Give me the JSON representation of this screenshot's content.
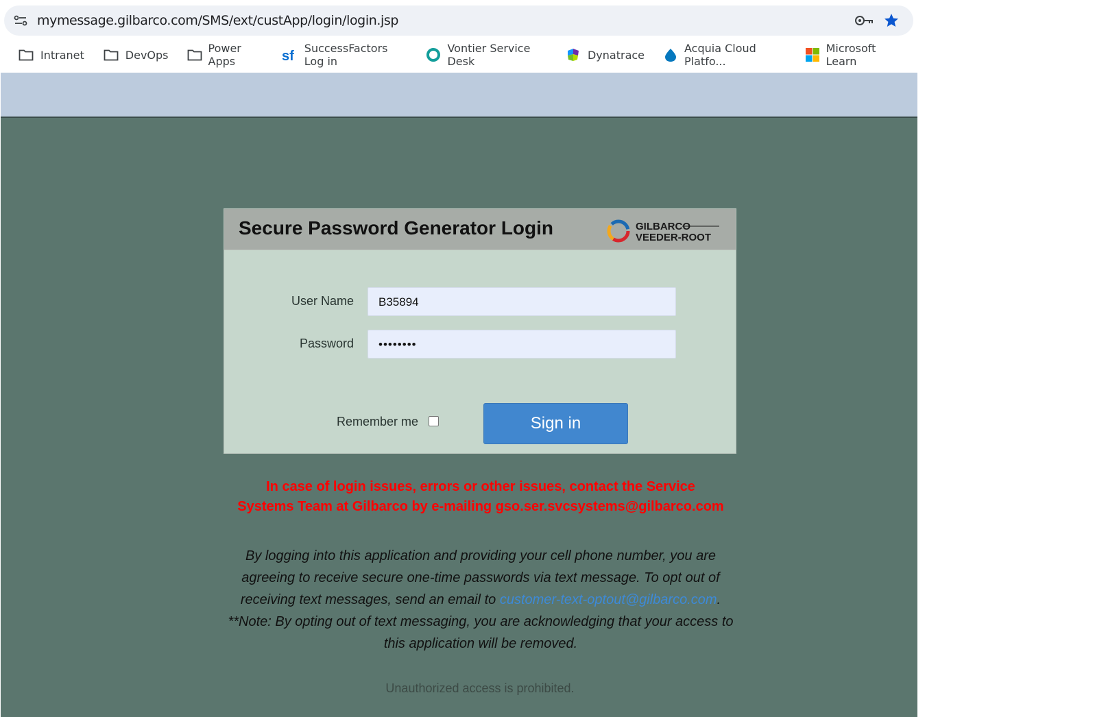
{
  "browser": {
    "url": "mymessage.gilbarco.com/SMS/ext/custApp/login/login.jsp",
    "bookmarks": [
      {
        "label": "Intranet",
        "icon": "folder-icon"
      },
      {
        "label": "DevOps",
        "icon": "folder-icon"
      },
      {
        "label": "Power Apps",
        "icon": "folder-icon"
      },
      {
        "label": "SuccessFactors Log in",
        "icon": "successfactors-icon"
      },
      {
        "label": "Vontier Service Desk",
        "icon": "vontier-icon"
      },
      {
        "label": "Dynatrace",
        "icon": "dynatrace-icon"
      },
      {
        "label": "Acquia Cloud Platfo...",
        "icon": "acquia-icon"
      },
      {
        "label": "Microsoft Learn",
        "icon": "microsoft-icon"
      }
    ]
  },
  "login": {
    "title": "Secure Password Generator Login",
    "logo_text_line1": "GILBARCO",
    "logo_text_line2": "VEEDER-ROOT",
    "username_label": "User Name",
    "username_value": "B35894",
    "password_label": "Password",
    "password_value": "••••••••",
    "remember_label": "Remember me",
    "signin_label": "Sign in"
  },
  "notice": {
    "line1": "In case of login issues, errors or other issues, contact the Service",
    "line2": "Systems Team at Gilbarco by e-mailing gso.ser.svcsystems@gilbarco.com"
  },
  "disclaimer": {
    "text1": "By logging into this application and providing your cell phone number, you are agreeing to receive secure one-time passwords via text message. To opt out of receiving text messages, send an email to ",
    "email": "customer-text-optout@gilbarco.com",
    "text2": ". **Note: By opting out of text messaging, you are acknowledging that your access to this application will be removed."
  },
  "footer": {
    "unauthorized": "Unauthorized access is prohibited."
  },
  "colors": {
    "header_strip": "#bccbdd",
    "page_bg": "#5b766e",
    "panel_bg": "#c6d7cc",
    "button": "#4187cf",
    "notice": "#ff0000",
    "link": "#3d8ad8"
  }
}
